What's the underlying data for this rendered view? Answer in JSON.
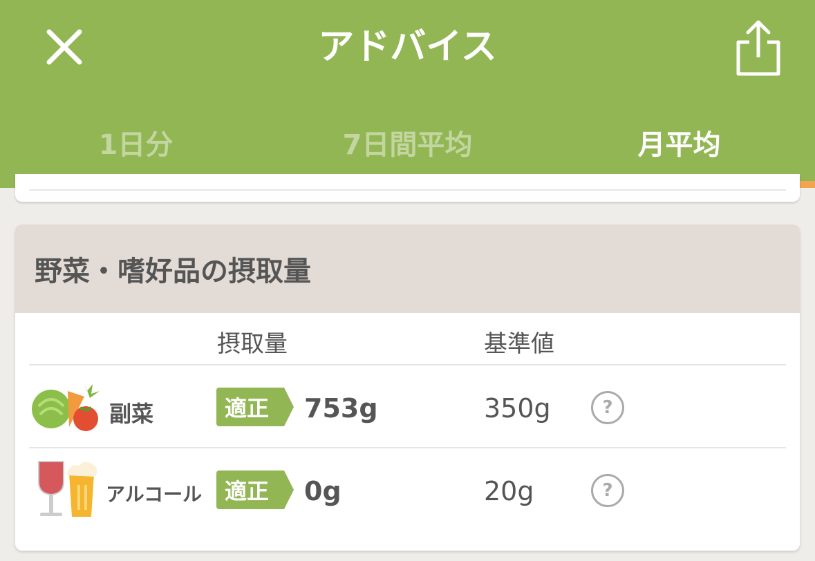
{
  "header": {
    "title": "アドバイス",
    "close_icon": "close-icon",
    "share_icon": "share-icon",
    "background": "#92b653"
  },
  "tabs": [
    {
      "label": "1日分",
      "active": false
    },
    {
      "label": "7日間平均",
      "active": false
    },
    {
      "label": "月平均",
      "active": true
    }
  ],
  "accent": "#f2a44f",
  "card": {
    "title": "野菜・嗜好品の摂取量",
    "columns": {
      "intake": "摂取量",
      "standard": "基準値"
    },
    "rows": [
      {
        "icon": "vegetables-icon",
        "label": "副菜",
        "badge": "適正",
        "intake": "753g",
        "standard": "350g",
        "help": "?"
      },
      {
        "icon": "wine-beer-icon",
        "label": "アルコール",
        "badge": "適正",
        "intake": "0g",
        "standard": "20g",
        "help": "?"
      }
    ]
  }
}
